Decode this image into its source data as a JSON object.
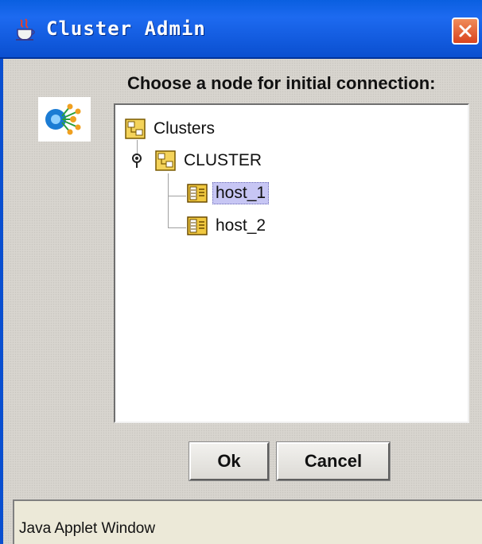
{
  "window": {
    "title": "Cluster Admin",
    "close_icon": "close-icon",
    "accent_color": "#0a5fe0"
  },
  "dialog": {
    "prompt": "Choose a node for initial connection:",
    "logo_icon": "cluster-network-icon"
  },
  "tree": {
    "root": {
      "label": "Clusters",
      "icon": "cluster-folder-icon"
    },
    "cluster": {
      "label": "CLUSTER",
      "icon": "cluster-folder-icon",
      "expanded": true
    },
    "hosts": [
      {
        "label": "host_1",
        "icon": "server-icon",
        "selected": true
      },
      {
        "label": "host_2",
        "icon": "server-icon",
        "selected": false
      }
    ]
  },
  "buttons": {
    "ok_label": "Ok",
    "cancel_label": "Cancel"
  },
  "status_bar": {
    "text": "Java Applet Window"
  }
}
